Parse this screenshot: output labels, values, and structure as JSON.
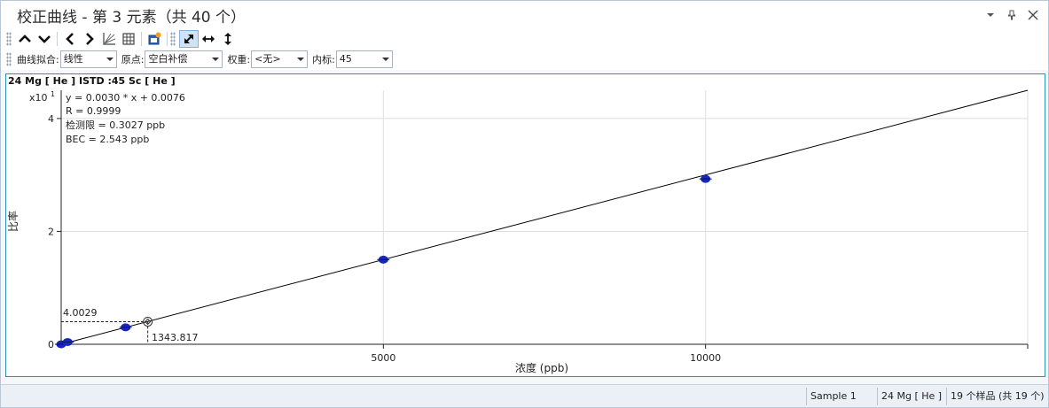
{
  "window": {
    "title": "校正曲线 - 第 3 元素（共 40 个）"
  },
  "toolbar2": {
    "fit_label": "曲线拟合:",
    "fit_value": "线性",
    "origin_label": "原点:",
    "origin_value": "空白补偿",
    "weight_label": "权重:",
    "weight_value": "<无>",
    "istd_label": "内标:",
    "istd_value": "45"
  },
  "chart": {
    "header": "24  Mg  [ He ]  ISTD :45  Sc  [ He ]",
    "scale_label": "x10",
    "scale_exponent": "1",
    "equation": "y = 0.0030 * x  + 0.0076",
    "r_value": "R =  0.9999",
    "dl": "检测限 = 0.3027 ppb",
    "bec": "BEC = 2.543 ppb",
    "cursor_y": "4.0029",
    "cursor_x": "1343.817",
    "ylabel": "比率",
    "xlabel": "浓度 (ppb)",
    "colors": {
      "points": "#1626c4",
      "line": "#000000",
      "grid": "#dedede"
    }
  },
  "chart_data": {
    "type": "scatter",
    "title": "24  Mg  [ He ]  ISTD :45  Sc  [ He ]",
    "xlabel": "浓度 (ppb)",
    "ylabel": "比率",
    "y_multiplier": "x10 1",
    "xlim": [
      0,
      15000
    ],
    "ylim": [
      0,
      4.5
    ],
    "x_ticks": [
      5000,
      10000
    ],
    "y_ticks": [
      0,
      2,
      4
    ],
    "grid": true,
    "points": [
      {
        "x": 0,
        "y": 0.0
      },
      {
        "x": 100,
        "y": 0.04
      },
      {
        "x": 1000,
        "y": 0.3
      },
      {
        "x": 5000,
        "y": 1.5
      },
      {
        "x": 10000,
        "y": 2.93
      }
    ],
    "fit_line": {
      "x0": 0,
      "y0": 0.0,
      "x1": 15000,
      "y1": 4.5
    },
    "cursor": {
      "x": 1343.817,
      "y": 0.40029
    }
  },
  "status": {
    "sample": "Sample 1",
    "element": "24  Mg  [ He ]",
    "count": "19 个样品 (共 19 个)"
  },
  "icons": {
    "toolbar": [
      "chevron-up-icon",
      "chevron-down-icon",
      "chevron-left-icon",
      "chevron-right-icon",
      "graph-icon",
      "table-icon",
      "export-icon",
      "fit-both-icon",
      "fit-horizontal-icon",
      "fit-vertical-icon"
    ]
  }
}
